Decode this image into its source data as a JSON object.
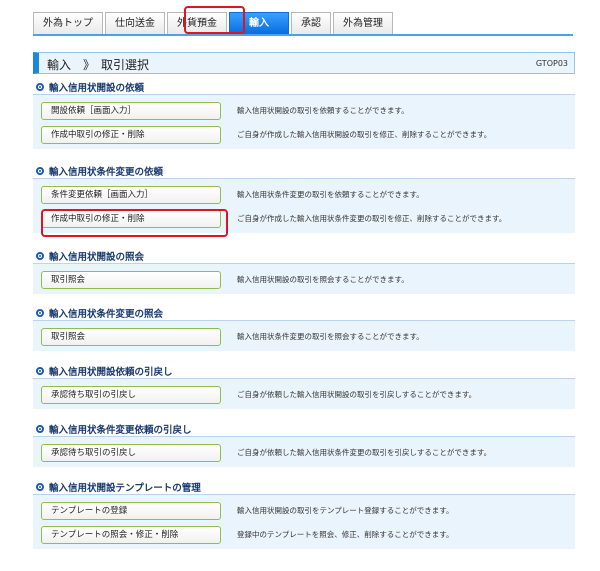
{
  "tabs": [
    {
      "label": "外為トップ"
    },
    {
      "label": "仕向送金"
    },
    {
      "label": "外貨預金"
    },
    {
      "label": "輸入"
    },
    {
      "label": "承認"
    },
    {
      "label": "外為管理"
    }
  ],
  "active_tab": "輸入",
  "page": {
    "title": "輸入　》　取引選択",
    "code": "GTOP03"
  },
  "sections": [
    {
      "title": "輸入信用状開設の依頼",
      "rows": [
        {
          "button": "開設依頼［画面入力］",
          "description": "輸入信用状開設の取引を依頼することができます。"
        },
        {
          "button": "作成中取引の修正・削除",
          "description": "ご自身が作成した輸入信用状開設の取引を修正、削除することができます。"
        }
      ]
    },
    {
      "title": "輸入信用状条件変更の依頼",
      "rows": [
        {
          "button": "条件変更依頼［画面入力］",
          "description": "輸入信用状条件変更の取引を依頼することができます。"
        },
        {
          "button": "作成中取引の修正・削除",
          "description": "ご自身が作成した輸入信用状条件変更の取引を修正、削除することができます。"
        }
      ]
    },
    {
      "title": "輸入信用状開設の照会",
      "rows": [
        {
          "button": "取引照会",
          "description": "輸入信用状開設の取引を照会することができます。"
        }
      ]
    },
    {
      "title": "輸入信用状条件変更の照会",
      "rows": [
        {
          "button": "取引照会",
          "description": "輸入信用状条件変更の取引を照会することができます。"
        }
      ]
    },
    {
      "title": "輸入信用状開設依頼の引戻し",
      "rows": [
        {
          "button": "承認待ち取引の引戻し",
          "description": "ご自身が依頼した輸入信用状開設の取引を引戻しすることができます。"
        }
      ]
    },
    {
      "title": "輸入信用状条件変更依頼の引戻し",
      "rows": [
        {
          "button": "承認待ち取引の引戻し",
          "description": "ご自身が依頼した輸入信用状条件変更の取引を引戻しすることができます。"
        }
      ]
    },
    {
      "title": "輸入信用状開設テンプレートの管理",
      "rows": [
        {
          "button": "テンプレートの登録",
          "description": "輸入信用状開設の取引をテンプレート登録することができます。"
        },
        {
          "button": "テンプレートの照会・修正・削除",
          "description": "登録中のテンプレートを照会、修正、削除することができます。"
        }
      ]
    }
  ],
  "colors": {
    "accent": "#1e87d6",
    "active_tab": "#0a6fe0",
    "panel_bg": "#eaf4fc",
    "button_border": "#8cc04b",
    "highlight": "#e0141e"
  }
}
